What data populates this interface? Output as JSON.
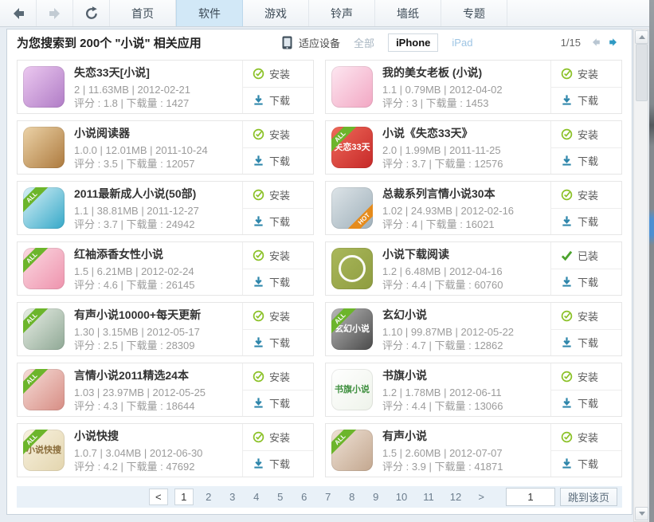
{
  "toolbar": {
    "tabs": [
      {
        "label": "首页",
        "active": false
      },
      {
        "label": "软件",
        "active": true
      },
      {
        "label": "游戏",
        "active": false
      },
      {
        "label": "铃声",
        "active": false
      },
      {
        "label": "墙纸",
        "active": false
      },
      {
        "label": "专题",
        "active": false
      }
    ]
  },
  "header": {
    "title": "为您搜索到 200个 \"小说\" 相关应用",
    "device_label": "适应设备",
    "filters": [
      {
        "label": "全部",
        "selected": false
      },
      {
        "label": "iPhone",
        "selected": true
      },
      {
        "label": "iPad",
        "selected": false
      }
    ],
    "page_indicator": "1/15"
  },
  "labels": {
    "download": "下载"
  },
  "apps": [
    {
      "title": "失恋33天[小说]",
      "meta": "2 | 11.63MB | 2012-02-21",
      "stats": "评分 : 1.8 | 下载量 : 1427",
      "action": "安装",
      "badge": "",
      "icon": {
        "c1": "#ecc9f0",
        "c2": "#b07cc6",
        "text": ""
      }
    },
    {
      "title": "我的美女老板 (小说)",
      "meta": "1.1 | 0.79MB | 2012-04-02",
      "stats": "评分 : 3 | 下载量 : 1453",
      "action": "安装",
      "badge": "",
      "icon": {
        "c1": "#fde7f1",
        "c2": "#f2a7c3",
        "text": ""
      }
    },
    {
      "title": "小说阅读器",
      "meta": "1.0.0 | 12.01MB | 2011-10-24",
      "stats": "评分 : 3.5 | 下载量 : 12057",
      "action": "安装",
      "badge": "",
      "icon": {
        "c1": "#ecd3a8",
        "c2": "#ad7a3e",
        "text": ""
      }
    },
    {
      "title": "小说《失恋33天》",
      "meta": "2.0 | 1.99MB | 2011-11-25",
      "stats": "评分 : 3.7 | 下载量 : 12576",
      "action": "安装",
      "badge": "ALL",
      "icon": {
        "c1": "#ef6a5a",
        "c2": "#c62828",
        "text": "失恋33天"
      }
    },
    {
      "title": "2011最新成人小说(50部)",
      "meta": "1.1 | 38.81MB | 2011-12-27",
      "stats": "评分 : 3.7 | 下载量 : 24942",
      "action": "安装",
      "badge": "ALL",
      "icon": {
        "c1": "#d8f1f7",
        "c2": "#35a8c8",
        "text": ""
      }
    },
    {
      "title": "总裁系列言情小说30本",
      "meta": "1.02 | 24.93MB | 2012-02-16",
      "stats": "评分 : 4 | 下载量 : 16021",
      "action": "安装",
      "badge": "HOT",
      "icon": {
        "c1": "#dde4e8",
        "c2": "#9fb0ba",
        "text": ""
      }
    },
    {
      "title": "红袖添香女性小说",
      "meta": "1.5 | 6.21MB | 2012-02-24",
      "stats": "评分 : 4.6 | 下载量 : 26145",
      "action": "安装",
      "badge": "ALL",
      "icon": {
        "c1": "#fbd9e2",
        "c2": "#ee93ad",
        "text": ""
      }
    },
    {
      "title": "小说下载阅读",
      "meta": "1.2 | 6.48MB | 2012-04-16",
      "stats": "评分 : 4.4 | 下载量 : 60760",
      "action": "已装",
      "badge": "",
      "icon": {
        "c1": "#aab85b",
        "c2": "#8e9c40",
        "text": "",
        "style": "ring"
      }
    },
    {
      "title": "有声小说10000+每天更新",
      "meta": "1.30 | 3.15MB | 2012-05-17",
      "stats": "评分 : 2.5 | 下载量 : 28309",
      "action": "安装",
      "badge": "ALL",
      "icon": {
        "c1": "#e9efe6",
        "c2": "#8fa895",
        "text": ""
      }
    },
    {
      "title": "玄幻小说",
      "meta": "1.10 | 99.87MB | 2012-05-22",
      "stats": "评分 : 4.7 | 下载量 : 12862",
      "action": "安装",
      "badge": "ALL",
      "icon": {
        "c1": "#b8b8b8",
        "c2": "#4a4a4a",
        "text": "玄幻小说"
      }
    },
    {
      "title": "言情小说2011精选24本",
      "meta": "1.03 | 23.97MB | 2012-05-25",
      "stats": "评分 : 4.3 | 下载量 : 18644",
      "action": "安装",
      "badge": "ALL",
      "icon": {
        "c1": "#f6ddd8",
        "c2": "#d78d84",
        "text": ""
      }
    },
    {
      "title": "书旗小说",
      "meta": "1.2 | 1.78MB | 2012-06-11",
      "stats": "评分 : 4.4 | 下载量 : 13066",
      "action": "安装",
      "badge": "",
      "icon": {
        "c1": "#ffffff",
        "c2": "#eef3ea",
        "text": "书旗小说",
        "fg": "#3e8f3e"
      }
    },
    {
      "title": "小说快搜",
      "meta": "1.0.7 | 3.04MB | 2012-06-30",
      "stats": "评分 : 4.2 | 下载量 : 47692",
      "action": "安装",
      "badge": "ALL",
      "icon": {
        "c1": "#f8f2e0",
        "c2": "#e3d5ae",
        "text": "小说快搜",
        "fg": "#8a6d3b"
      }
    },
    {
      "title": "有声小说",
      "meta": "1.5 | 2.60MB | 2012-07-07",
      "stats": "评分 : 3.9 | 下载量 : 41871",
      "action": "安装",
      "badge": "ALL",
      "icon": {
        "c1": "#efe2d6",
        "c2": "#c3a78f",
        "text": ""
      }
    }
  ],
  "pagination": {
    "prev_label": "<",
    "next_label": ">",
    "pages": [
      "1",
      "2",
      "3",
      "4",
      "5",
      "6",
      "7",
      "8",
      "9",
      "10",
      "11",
      "12"
    ],
    "current": "1",
    "jump_value": "1",
    "jump_label": "跳到该页"
  }
}
